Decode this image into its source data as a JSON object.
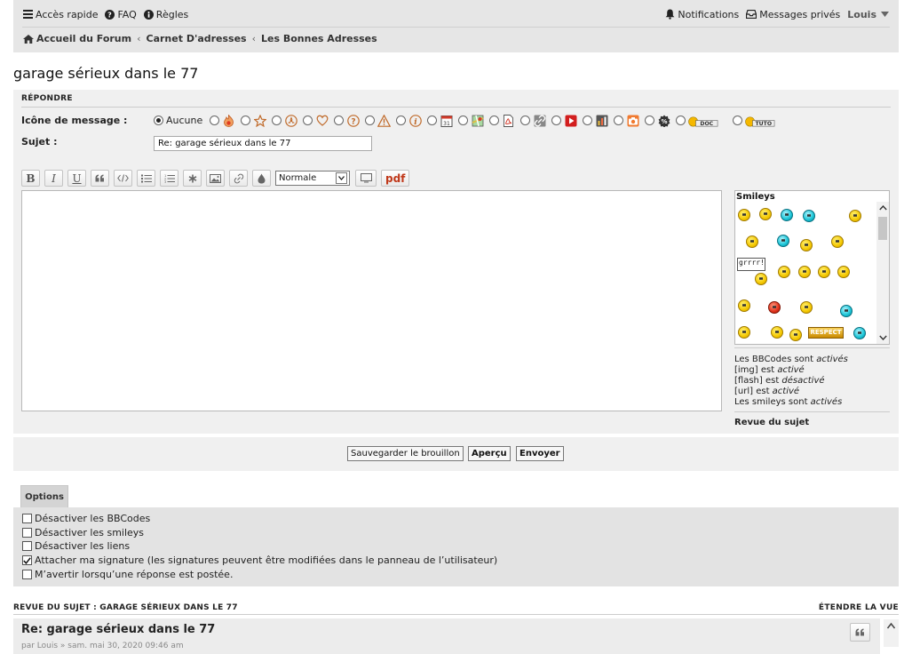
{
  "nav": {
    "quick_access": "Accès rapide",
    "faq": "FAQ",
    "rules": "Règles",
    "notifications": "Notifications",
    "private_messages": "Messages privés",
    "username": "Louis"
  },
  "breadcrumb": [
    "Accueil du Forum",
    "Carnet D'adresses",
    "Les Bonnes Adresses"
  ],
  "page_title": "garage sérieux dans le 77",
  "reply": {
    "header": "RÉPONDRE",
    "icon_label": "Icône de message :",
    "icon_none": "Aucune",
    "subject_label": "Sujet :",
    "subject_value": "Re: garage sérieux dans le 77"
  },
  "toolbar": {
    "bold": "B",
    "italic": "I",
    "underline": "U",
    "font_size": "Normale",
    "pdf": "pdf"
  },
  "smileys": {
    "title": "Smileys",
    "grrr": "grrrr!",
    "respect": "RESPECT"
  },
  "bbcode_info": {
    "l1_a": "Les BBCodes sont ",
    "l1_b": "activés",
    "l2_a": "[img] est ",
    "l2_b": "activé",
    "l3_a": "[flash] est ",
    "l3_b": "désactivé",
    "l4_a": "[url] est ",
    "l4_b": "activé",
    "l5_a": "Les smileys sont ",
    "l5_b": "activés",
    "topic_review": "Revue du sujet"
  },
  "buttons": {
    "save_draft": "Sauvegarder le brouillon",
    "preview": "Aperçu",
    "submit": "Envoyer"
  },
  "options": {
    "tab": "Options",
    "items": [
      {
        "label": "Désactiver les BBCodes",
        "checked": false
      },
      {
        "label": "Désactiver les smileys",
        "checked": false
      },
      {
        "label": "Désactiver les liens",
        "checked": false
      },
      {
        "label": "Attacher ma signature (les signatures peuvent être modifiées dans le panneau de l’utilisateur)",
        "checked": true
      },
      {
        "label": "M’avertir lorsqu’une réponse est postée.",
        "checked": false
      }
    ]
  },
  "review": {
    "header": "REVUE DU SUJET : GARAGE SÉRIEUX DANS LE 77",
    "expand": "ÉTENDRE LA VUE",
    "post_title": "Re: garage sérieux dans le 77",
    "post_meta": "par Louis » sam. mai 30, 2020 09:46 am"
  },
  "colors": {
    "topbar": "#e6e6e6",
    "panel": "#f0f0f0",
    "options_panel": "#e3e3e3",
    "pdf": "#c0391b"
  }
}
